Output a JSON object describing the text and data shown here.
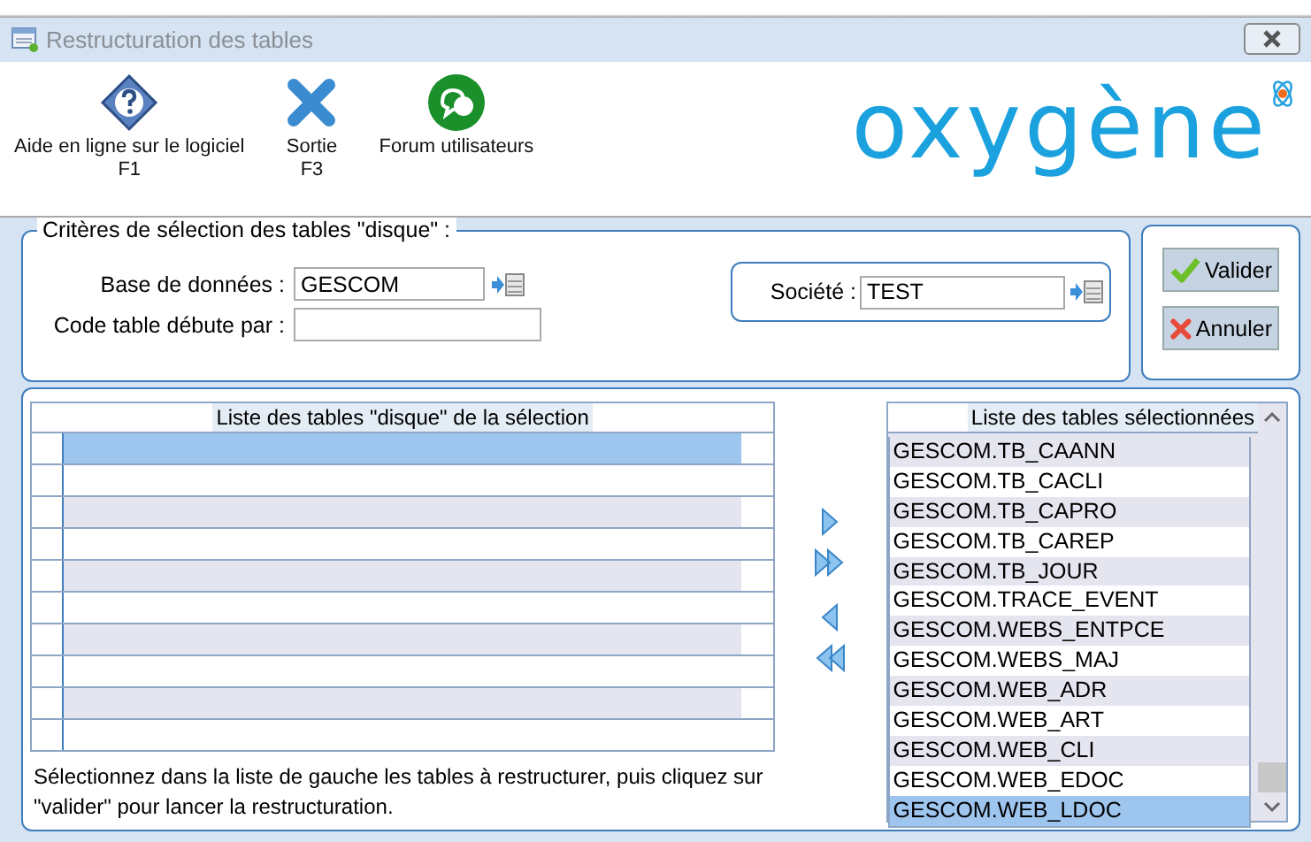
{
  "window": {
    "title": "Restructuration des tables"
  },
  "toolbar": [
    {
      "kind": "help",
      "label": "Aide en ligne sur le logiciel",
      "key": "F1"
    },
    {
      "kind": "exit",
      "label": "Sortie",
      "key": "F3"
    },
    {
      "kind": "forum",
      "label": "Forum utilisateurs"
    }
  ],
  "logo": {
    "text": "oxygène"
  },
  "criteria": {
    "title": "Critères de sélection des tables \"disque\" :",
    "database": {
      "label": "Base de données :",
      "value": "GESCOM"
    },
    "code_prefix": {
      "label": "Code table débute par :"
    },
    "company": {
      "label": "Société :",
      "value": "TEST"
    }
  },
  "actions": [
    {
      "kind": "ok",
      "label": "Valider"
    },
    {
      "kind": "cancel",
      "label": "Annuler"
    }
  ],
  "left_list": {
    "title": "Liste des tables \"disque\" de la sélection",
    "rows": [
      {
        "selected": true
      },
      {
        "selected": false
      },
      {
        "selected": false
      },
      {
        "selected": false
      },
      {
        "selected": false
      },
      {
        "selected": false
      },
      {
        "selected": false
      },
      {
        "selected": false
      },
      {
        "selected": false
      },
      {
        "selected": false
      }
    ]
  },
  "instructions": "Sélectionnez dans la liste de gauche les tables à restructurer, puis cliquez sur \"valider\" pour lancer la restructuration.",
  "transfer_buttons": [
    {
      "kind": "add"
    },
    {
      "kind": "add_all"
    },
    {
      "kind": "remove"
    },
    {
      "kind": "remove_all"
    }
  ],
  "right_list": {
    "title": "Liste des tables sélectionnées",
    "items": [
      {
        "name": "GESCOM.TB_CAANN",
        "selected": false
      },
      {
        "name": "GESCOM.TB_CACLI",
        "selected": false
      },
      {
        "name": "GESCOM.TB_CAPRO",
        "selected": false
      },
      {
        "name": "GESCOM.TB_CAREP",
        "selected": false
      },
      {
        "name": "GESCOM.TB_JOUR",
        "selected": false
      },
      {
        "name": "GESCOM.TRACE_EVENT",
        "selected": false
      },
      {
        "name": "GESCOM.WEBS_ENTPCE",
        "selected": false
      },
      {
        "name": "GESCOM.WEBS_MAJ",
        "selected": false
      },
      {
        "name": "GESCOM.WEB_ADR",
        "selected": false
      },
      {
        "name": "GESCOM.WEB_ART",
        "selected": false
      },
      {
        "name": "GESCOM.WEB_CLI",
        "selected": false
      },
      {
        "name": "GESCOM.WEB_EDOC",
        "selected": false
      },
      {
        "name": "GESCOM.WEB_LDOC",
        "selected": true
      }
    ]
  }
}
